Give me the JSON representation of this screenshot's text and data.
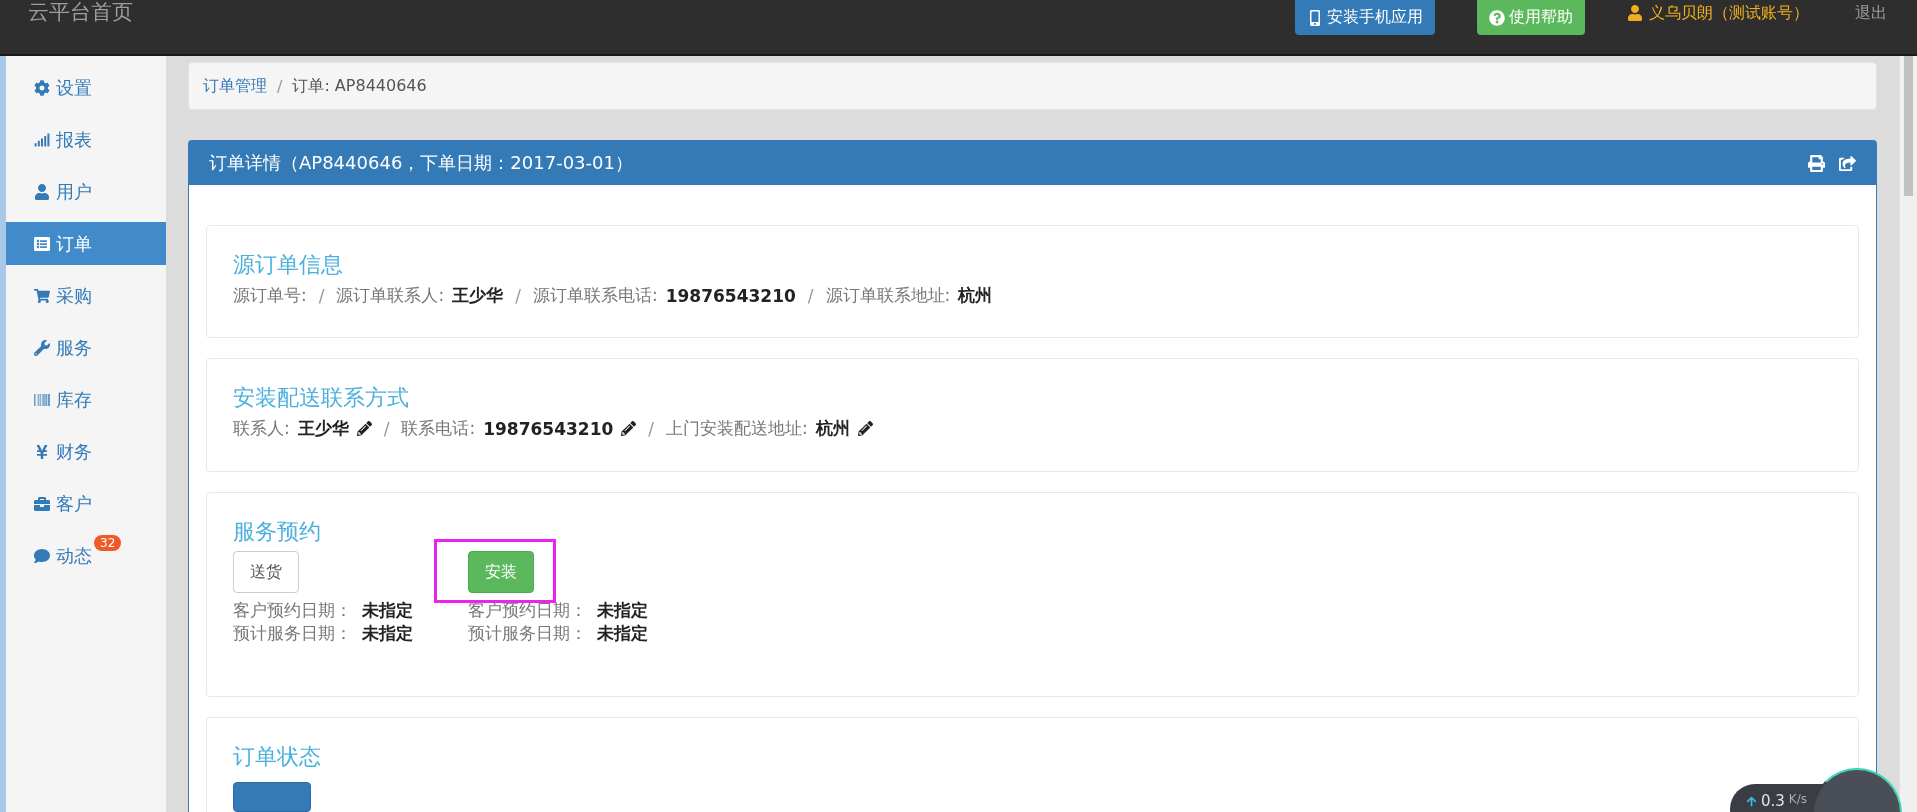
{
  "top_bar": {
    "title": "云平台首页",
    "buttons": [
      {
        "label": "安装手机应用",
        "kind": "primary"
      },
      {
        "label": "使用帮助",
        "kind": "success"
      }
    ],
    "user": "义乌贝朗（测试账号）",
    "logout": "退出"
  },
  "sidebar": {
    "items": [
      {
        "label": "设置",
        "selected": false
      },
      {
        "label": "报表",
        "selected": false
      },
      {
        "label": "用户",
        "selected": false
      },
      {
        "label": "订单",
        "selected": true
      },
      {
        "label": "采购",
        "selected": false
      },
      {
        "label": "服务",
        "selected": false
      },
      {
        "label": "库存",
        "selected": false
      },
      {
        "label": "财务",
        "selected": false
      },
      {
        "label": "客户",
        "selected": false
      },
      {
        "label": "动态",
        "selected": false,
        "badge": "32"
      }
    ]
  },
  "breadcrumb": {
    "items": [
      "订单管理",
      "订单: AP8440646"
    ],
    "separator": "/"
  },
  "panel": {
    "title": "订单详情（AP8440646，下单日期：2017-03-01）",
    "source_order": {
      "title": "源订单信息",
      "separator": "/",
      "fields": [
        {
          "label": "源订单号:"
        },
        {
          "label": "源订单联系人:",
          "value": "王少华"
        },
        {
          "label": "源订单联系电话:",
          "value": "19876543210"
        },
        {
          "label": "源订单联系地址:",
          "value": "杭州"
        }
      ]
    },
    "contact": {
      "title": "安装配送联系方式",
      "separator": "/",
      "fields": [
        {
          "label": "联系人:",
          "value": "王少华",
          "editable": true
        },
        {
          "label": "联系电话:",
          "value": "19876543210",
          "editable": true
        },
        {
          "label": "上门安装配送地址:",
          "value": "杭州",
          "editable": true
        }
      ]
    },
    "service": {
      "title": "服务预约",
      "columns": [
        {
          "button": "送货",
          "kind": "default",
          "highlighted": false,
          "rows": [
            {
              "label": "客户预约日期：",
              "value": "未指定"
            },
            {
              "label": "预计服务日期：",
              "value": "未指定"
            }
          ]
        },
        {
          "button": "安装",
          "kind": "success",
          "highlighted": true,
          "rows": [
            {
              "label": "客户预约日期：",
              "value": "未指定"
            },
            {
              "label": "预计服务日期：",
              "value": "未指定"
            }
          ]
        }
      ]
    },
    "order_status": {
      "title": "订单状态"
    }
  },
  "speed_widget": {
    "speed": "0.3",
    "unit": "K/s"
  }
}
